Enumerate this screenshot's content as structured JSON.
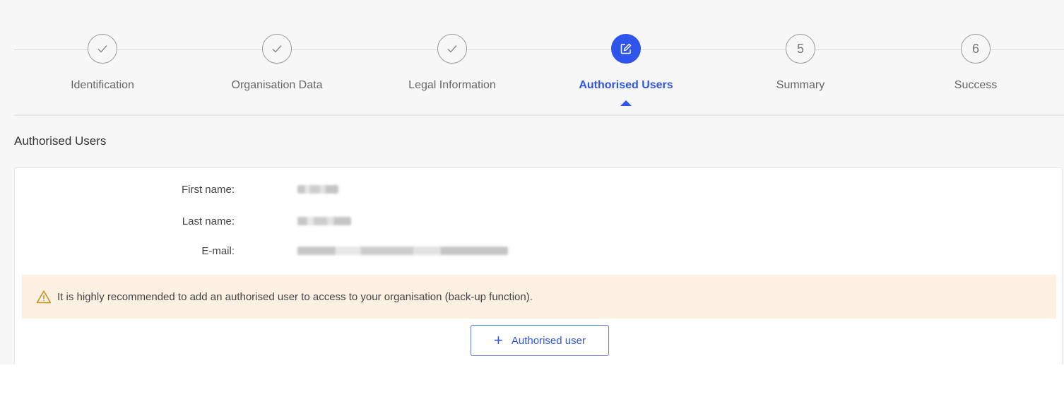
{
  "stepper": {
    "steps": [
      {
        "label": "Identification",
        "state": "done",
        "icon": "check-icon"
      },
      {
        "label": "Organisation Data",
        "state": "done",
        "icon": "check-icon"
      },
      {
        "label": "Legal Information",
        "state": "done",
        "icon": "check-icon"
      },
      {
        "label": "Authorised Users",
        "state": "active",
        "icon": "edit-icon"
      },
      {
        "label": "Summary",
        "state": "pending",
        "number": "5"
      },
      {
        "label": "Success",
        "state": "pending",
        "number": "6"
      }
    ]
  },
  "section": {
    "title": "Authorised Users"
  },
  "user": {
    "first_name_label": "First name:",
    "last_name_label": "Last name:",
    "email_label": "E-mail:"
  },
  "alert": {
    "icon": "warning-icon",
    "text": "It is highly recommended to add an authorised user to access to your organisation (back-up function)."
  },
  "add_button": {
    "icon": "plus-icon",
    "label": "Authorised user"
  },
  "colors": {
    "accent": "#2f54eb",
    "alert_bg": "#fbf0e2",
    "page_bg": "#f7f7f8"
  }
}
